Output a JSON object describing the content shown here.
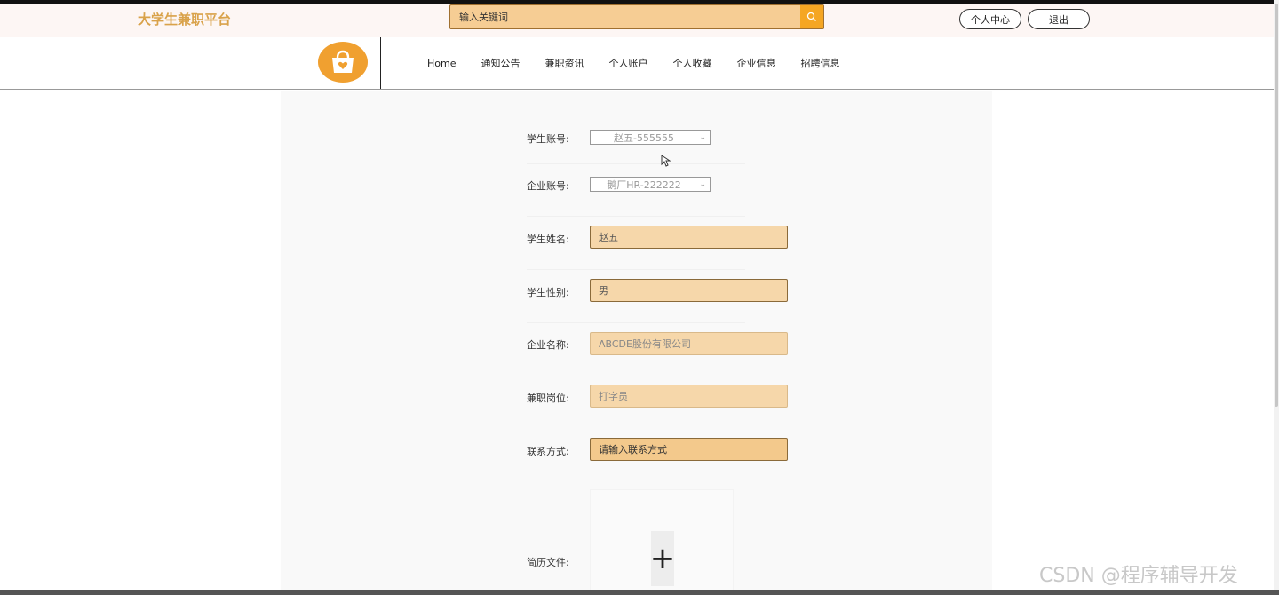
{
  "header": {
    "site_title": "大学生兼职平台",
    "search_placeholder": "输入关键词",
    "personal_center": "个人中心",
    "logout": "退出"
  },
  "nav": {
    "items": [
      "Home",
      "通知公告",
      "兼职资讯",
      "个人账户",
      "个人收藏",
      "企业信息",
      "招聘信息"
    ]
  },
  "form": {
    "student_account": {
      "label": "学生账号:",
      "value": "赵五-555555"
    },
    "company_account": {
      "label": "企业账号:",
      "value": "鹅厂HR-222222"
    },
    "student_name": {
      "label": "学生姓名:",
      "value": "赵五"
    },
    "student_gender": {
      "label": "学生性别:",
      "value": "男"
    },
    "company_name": {
      "label": "企业名称:",
      "value": "ABCDE股份有限公司"
    },
    "part_time_job": {
      "label": "兼职岗位:",
      "value": "打字员"
    },
    "contact": {
      "label": "联系方式:",
      "placeholder": "请输入联系方式"
    },
    "resume": {
      "label": "简历文件:",
      "add_symbol": "+"
    }
  },
  "watermark": "CSDN @程序辅导开发",
  "colors": {
    "brand": "#d9a24a",
    "input_bg": "#f6d7aa",
    "search_button": "#f5a623",
    "logo_bg": "#f0a030"
  },
  "icons": {
    "search": "search-icon",
    "logo": "shopping-bag-heart-icon",
    "dropdown": "chevron-down-icon",
    "upload": "plus-icon"
  }
}
